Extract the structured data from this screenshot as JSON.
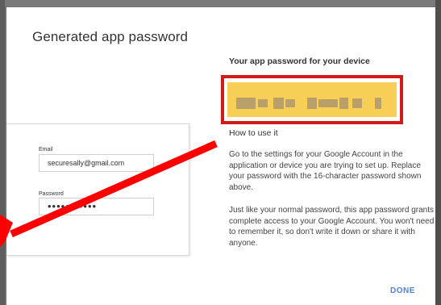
{
  "dialog": {
    "title": "Generated app password",
    "device_label": "Your app password for your device",
    "app_password": "",
    "howto_title": "How to use it",
    "howto_paragraph_1": "Go to the settings for your Google Account in the application or device you are trying to set up. Replace your password with the 16-character password shown above.",
    "howto_paragraph_2": "Just like your normal password, this app password grants complete access to your Google Account. You won't need to remember it, so don't write it down or share it with anyone.",
    "done_label": "DONE"
  },
  "device": {
    "email_label": "Email",
    "email_value": "securesally@gmail.com",
    "password_label": "Password",
    "password_value": "•••••••••••"
  },
  "annotation": {
    "highlight_color": "#d11a1a",
    "arrow_color": "#ff0000"
  }
}
